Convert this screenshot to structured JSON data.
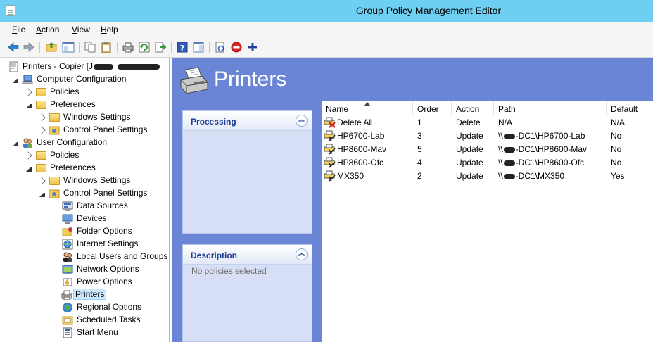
{
  "window": {
    "title": "Group Policy Management Editor"
  },
  "menu": {
    "file": "File",
    "action": "Action",
    "view": "View",
    "help": "Help"
  },
  "tree": {
    "root": "Printers - Copier [J",
    "root_suffix": "",
    "items": [
      {
        "label": "Computer Configuration"
      },
      {
        "label": "Policies"
      },
      {
        "label": "Preferences"
      },
      {
        "label": "Windows Settings"
      },
      {
        "label": "Control Panel Settings"
      },
      {
        "label": "User Configuration"
      },
      {
        "label": "Policies"
      },
      {
        "label": "Preferences"
      },
      {
        "label": "Windows Settings"
      },
      {
        "label": "Control Panel Settings"
      },
      {
        "label": "Data Sources"
      },
      {
        "label": "Devices"
      },
      {
        "label": "Folder Options"
      },
      {
        "label": "Internet Settings"
      },
      {
        "label": "Local Users and Groups"
      },
      {
        "label": "Network Options"
      },
      {
        "label": "Power Options"
      },
      {
        "label": "Printers"
      },
      {
        "label": "Regional Options"
      },
      {
        "label": "Scheduled Tasks"
      },
      {
        "label": "Start Menu"
      }
    ]
  },
  "header": {
    "title": "Printers"
  },
  "processing": {
    "title": "Processing"
  },
  "description": {
    "title": "Description",
    "text": "No policies selected"
  },
  "list": {
    "columns": [
      "Name",
      "Order",
      "Action",
      "Path",
      "Default"
    ],
    "rows": [
      {
        "name": "Delete All",
        "order": "1",
        "action": "Delete",
        "path_pre": "N/A",
        "path_post": "",
        "default": "N/A"
      },
      {
        "name": "HP6700-Lab",
        "order": "3",
        "action": "Update",
        "path_pre": "\\\\",
        "path_post": "-DC1\\HP6700-Lab",
        "default": "No"
      },
      {
        "name": "HP8600-Mav",
        "order": "5",
        "action": "Update",
        "path_pre": "\\\\",
        "path_post": "-DC1\\HP8600-Mav",
        "default": "No"
      },
      {
        "name": "HP8600-Ofc",
        "order": "4",
        "action": "Update",
        "path_pre": "\\\\",
        "path_post": "-DC1\\HP8600-Ofc",
        "default": "No"
      },
      {
        "name": "MX350",
        "order": "2",
        "action": "Update",
        "path_pre": "\\\\",
        "path_post": "-DC1\\MX350",
        "default": "Yes"
      }
    ]
  },
  "colors": {
    "titlebar": "#6dcff2",
    "panel_band": "#6b85d6",
    "panel_title": "#1e3e93"
  }
}
